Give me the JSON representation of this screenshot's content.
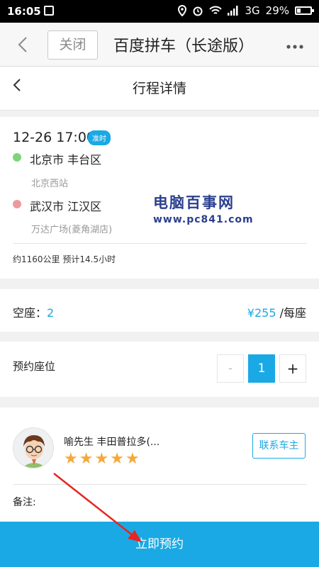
{
  "status_bar": {
    "time": "16:05",
    "network": "3G",
    "battery": "29%",
    "battery_level": 0.29
  },
  "nav": {
    "back_icon": "chevron-left-icon",
    "close_label": "关闭",
    "title": "百度拼车（长途版）",
    "more_icon": "more-dots-icon"
  },
  "page": {
    "title": "行程详情"
  },
  "trip": {
    "datetime": "12-26 17:00",
    "badge": "准时",
    "origin": "北京市 丰台区",
    "origin_detail": "北京西站",
    "destination": "武汉市 江汉区",
    "destination_detail": "万达广场(菱角湖店)",
    "summary": "约1160公里 预计14.5小时",
    "colors": {
      "origin_dot": "#7ed47e",
      "destination_dot": "#ec9a9a"
    }
  },
  "watermark": {
    "line1": "电脑百事网",
    "line2": "www.pc841.com"
  },
  "seats": {
    "label": "空座：",
    "count": "2",
    "price": "¥255",
    "price_unit": " /每座"
  },
  "booking": {
    "label": "预约座位",
    "minus": "-",
    "value": "1",
    "plus": "+"
  },
  "driver": {
    "name": "喻先生 丰田普拉多(...",
    "rating": 5,
    "rating_max": 5,
    "contact_label": "联系车主",
    "note_label": "备注:"
  },
  "action": {
    "book_label": "立即预约"
  },
  "colors": {
    "accent": "#1aa9e4",
    "star": "#f4a93a",
    "annotation_arrow": "#e8251f"
  }
}
